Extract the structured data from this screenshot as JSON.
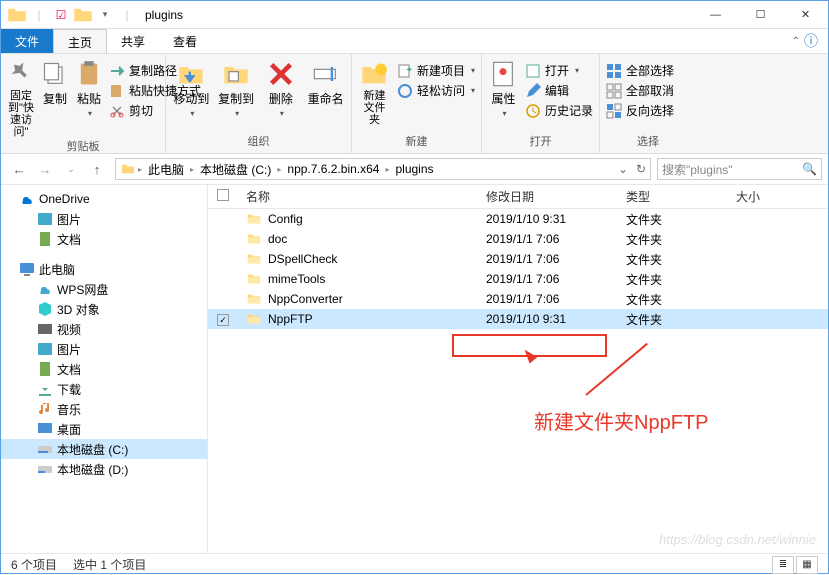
{
  "title": "plugins",
  "tabs": {
    "file": "文件",
    "home": "主页",
    "share": "共享",
    "view": "查看"
  },
  "ribbon": {
    "pin": "固定到\"快速访问\"",
    "copy": "复制",
    "paste": "粘贴",
    "copypath": "复制路径",
    "pasteshort": "粘贴快捷方式",
    "cut": "剪切",
    "clipboard": "剪贴板",
    "moveto": "移动到",
    "copyto": "复制到",
    "delete": "删除",
    "rename": "重命名",
    "organize": "组织",
    "newfolder": "新建文件夹",
    "newitem": "新建项目",
    "easyaccess": "轻松访问",
    "new": "新建",
    "properties": "属性",
    "open_": "打开",
    "edit": "编辑",
    "history": "历史记录",
    "open": "打开",
    "selectall": "全部选择",
    "selectnone": "全部取消",
    "invert": "反向选择",
    "select": "选择"
  },
  "breadcrumbs": [
    "此电脑",
    "本地磁盘 (C:)",
    "npp.7.6.2.bin.x64",
    "plugins"
  ],
  "search_placeholder": "搜索\"plugins\"",
  "tree": {
    "onedrive": "OneDrive",
    "pictures": "图片",
    "documents": "文档",
    "thispc": "此电脑",
    "wps": "WPS网盘",
    "objects3d": "3D 对象",
    "videos": "视频",
    "pictures2": "图片",
    "documents2": "文档",
    "downloads": "下载",
    "music": "音乐",
    "desktop": "桌面",
    "diskc": "本地磁盘 (C:)",
    "diskd": "本地磁盘 (D:)"
  },
  "columns": {
    "name": "名称",
    "date": "修改日期",
    "type": "类型",
    "size": "大小"
  },
  "rows": [
    {
      "name": "Config",
      "date": "2019/1/10 9:31",
      "type": "文件夹",
      "selected": false,
      "checked": false
    },
    {
      "name": "doc",
      "date": "2019/1/1 7:06",
      "type": "文件夹",
      "selected": false,
      "checked": false
    },
    {
      "name": "DSpellCheck",
      "date": "2019/1/1 7:06",
      "type": "文件夹",
      "selected": false,
      "checked": false
    },
    {
      "name": "mimeTools",
      "date": "2019/1/1 7:06",
      "type": "文件夹",
      "selected": false,
      "checked": false
    },
    {
      "name": "NppConverter",
      "date": "2019/1/1 7:06",
      "type": "文件夹",
      "selected": false,
      "checked": false
    },
    {
      "name": "NppFTP",
      "date": "2019/1/10 9:31",
      "type": "文件夹",
      "selected": true,
      "checked": true
    }
  ],
  "annotation_text": "新建文件夹NppFTP",
  "status": {
    "count": "6 个项目",
    "selected": "选中 1 个项目"
  },
  "watermark": "https://blog.csdn.net/winnie"
}
